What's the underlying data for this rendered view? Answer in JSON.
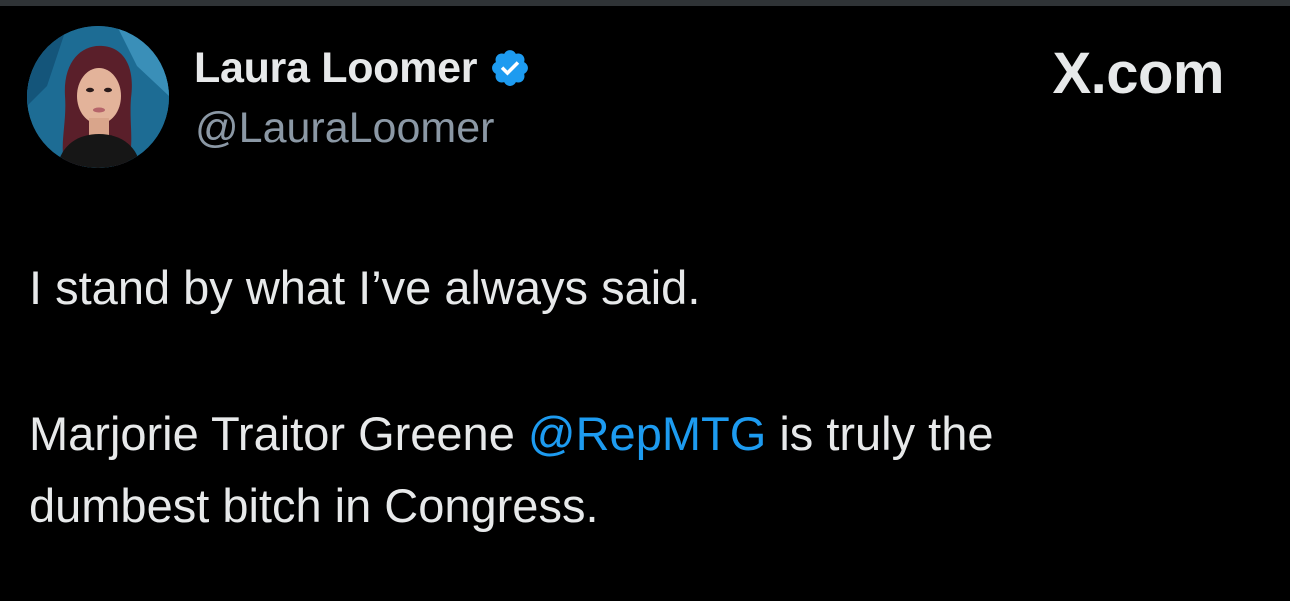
{
  "author": {
    "display_name": "Laura Loomer",
    "handle": "@LauraLoomer",
    "verified_badge": "verified-badge-icon",
    "avatar": "profile-photo"
  },
  "branding": {
    "site": "X.com"
  },
  "tweet": {
    "line1": "I stand by what I’ve always said.",
    "line2_before": "Marjorie Traitor Greene ",
    "mention": "@RepMTG",
    "line2_after": " is truly the",
    "line3": "dumbest bitch in Congress."
  },
  "colors": {
    "background": "#000000",
    "text": "#e7e9ea",
    "secondary_text": "#8b98a5",
    "accent": "#1d9bf0"
  }
}
